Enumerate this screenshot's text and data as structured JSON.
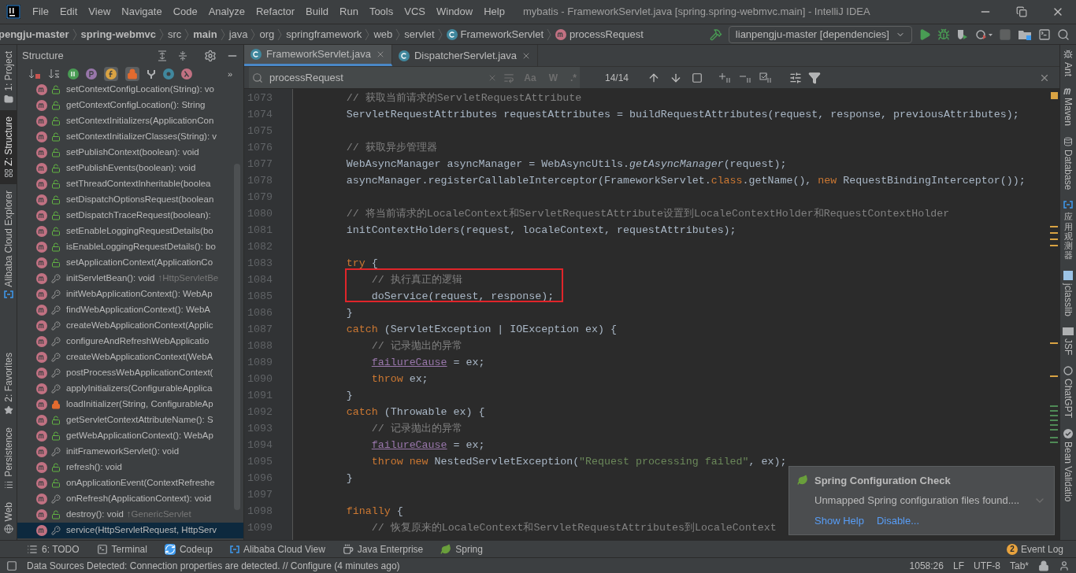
{
  "title_bar": {
    "menus": [
      "File",
      "Edit",
      "View",
      "Navigate",
      "Code",
      "Analyze",
      "Refactor",
      "Build",
      "Run",
      "Tools",
      "VCS",
      "Window",
      "Help"
    ],
    "title": "mybatis - FrameworkServlet.java [spring.spring-webmvc.main] - IntelliJ IDEA"
  },
  "nav_bar": {
    "breadcrumbs": [
      {
        "label": "pengju-master",
        "bold": true,
        "kind": "folder"
      },
      {
        "label": "spring-webmvc",
        "bold": true,
        "kind": "folder"
      },
      {
        "label": "src",
        "bold": false,
        "kind": "folder"
      },
      {
        "label": "main",
        "bold": true,
        "kind": "folder"
      },
      {
        "label": "java",
        "bold": false,
        "kind": "folder"
      },
      {
        "label": "org",
        "bold": false,
        "kind": "folder"
      },
      {
        "label": "springframework",
        "bold": false,
        "kind": "folder"
      },
      {
        "label": "web",
        "bold": false,
        "kind": "folder"
      },
      {
        "label": "servlet",
        "bold": false,
        "kind": "folder"
      },
      {
        "label": "FrameworkServlet",
        "bold": false,
        "kind": "class"
      },
      {
        "label": "processRequest",
        "bold": false,
        "kind": "method"
      }
    ],
    "run_config": "lianpengju-master [dependencies]"
  },
  "left_stripe": {
    "top": [
      {
        "label": "1: Project",
        "selected": false,
        "kind": "folder"
      },
      {
        "label": "Z: Structure",
        "selected": true,
        "kind": "structure"
      },
      {
        "label": "Alibaba Cloud Explorer",
        "selected": false,
        "kind": "cloud"
      }
    ],
    "bottom": [
      {
        "label": "2: Favorites",
        "selected": false,
        "kind": "star"
      },
      {
        "label": "Persistence",
        "selected": false,
        "kind": "persistence"
      },
      {
        "label": "Web",
        "selected": false,
        "kind": "globe"
      }
    ]
  },
  "structure": {
    "title": "Structure",
    "more": "»",
    "items": [
      {
        "text": "setContextConfigLocation(String): vo",
        "kind": "public",
        "selected": false
      },
      {
        "text": "getContextConfigLocation(): String",
        "kind": "public",
        "selected": false
      },
      {
        "text": "setContextInitializers(ApplicationCon",
        "kind": "public",
        "selected": false
      },
      {
        "text": "setContextInitializerClasses(String): v",
        "kind": "public",
        "selected": false
      },
      {
        "text": "setPublishContext(boolean): void",
        "kind": "public",
        "selected": false
      },
      {
        "text": "setPublishEvents(boolean): void",
        "kind": "public",
        "selected": false
      },
      {
        "text": "setThreadContextInheritable(boolea",
        "kind": "public",
        "selected": false
      },
      {
        "text": "setDispatchOptionsRequest(boolean",
        "kind": "public",
        "selected": false
      },
      {
        "text": "setDispatchTraceRequest(boolean):",
        "kind": "public",
        "selected": false
      },
      {
        "text": "setEnableLoggingRequestDetails(bo",
        "kind": "public",
        "selected": false
      },
      {
        "text": "isEnableLoggingRequestDetails(): bo",
        "kind": "public",
        "selected": false
      },
      {
        "text": "setApplicationContext(ApplicationCo",
        "kind": "public",
        "selected": false
      },
      {
        "text": "initServletBean(): void",
        "inherited": "↑HttpServletBe",
        "kind": "protected",
        "selected": false
      },
      {
        "text": "initWebApplicationContext(): WebAp",
        "kind": "protected",
        "selected": false
      },
      {
        "text": "findWebApplicationContext(): WebA",
        "kind": "protected",
        "selected": false
      },
      {
        "text": "createWebApplicationContext(Applic",
        "kind": "protected",
        "selected": false
      },
      {
        "text": "configureAndRefreshWebApplicatio",
        "kind": "protected",
        "selected": false
      },
      {
        "text": "createWebApplicationContext(WebA",
        "kind": "protected",
        "selected": false
      },
      {
        "text": "postProcessWebApplicationContext(",
        "kind": "protected",
        "selected": false
      },
      {
        "text": "applyInitializers(ConfigurableApplica",
        "kind": "protected",
        "selected": false
      },
      {
        "text": "loadInitializer(String, ConfigurableAp",
        "kind": "private",
        "selected": false
      },
      {
        "text": "getServletContextAttributeName(): S",
        "kind": "public",
        "selected": false
      },
      {
        "text": "getWebApplicationContext(): WebAp",
        "kind": "public",
        "selected": false
      },
      {
        "text": "initFrameworkServlet(): void",
        "kind": "protected",
        "selected": false
      },
      {
        "text": "refresh(): void",
        "kind": "public",
        "selected": false
      },
      {
        "text": "onApplicationEvent(ContextRefreshe",
        "kind": "public",
        "selected": false
      },
      {
        "text": "onRefresh(ApplicationContext): void",
        "kind": "protected",
        "selected": false
      },
      {
        "text": "destroy(): void",
        "inherited": "↑GenericServlet",
        "kind": "public",
        "selected": false
      },
      {
        "text": "service(HttpServletRequest, HttpServ",
        "kind": "protected",
        "selected": true
      }
    ]
  },
  "editor": {
    "tabs": [
      {
        "label": "FrameworkServlet.java",
        "selected": true
      },
      {
        "label": "DispatcherServlet.java",
        "selected": false
      }
    ],
    "search": {
      "value": "processRequest",
      "options": [
        "Aa",
        "W",
        ".*"
      ],
      "match_count": "14/14"
    },
    "lines": [
      {
        "number": "1073",
        "boxed": false,
        "segments": [
          {
            "kind": "comment",
            "text": "        // 获取当前请求的ServletRequestAttribute"
          }
        ]
      },
      {
        "number": "1074",
        "boxed": false,
        "segments": [
          {
            "kind": "plain",
            "text": "        ServletRequestAttributes requestAttributes = buildRequestAttributes(request, response, previousAttributes);"
          }
        ]
      },
      {
        "number": "1075",
        "boxed": false
      },
      {
        "number": "1076",
        "boxed": false,
        "segments": [
          {
            "kind": "comment",
            "text": "        // 获取异步管理器"
          }
        ]
      },
      {
        "number": "1077",
        "boxed": false,
        "segments": [
          {
            "kind": "plain",
            "text": "        WebAsyncManager asyncManager = WebAsyncUtils."
          },
          {
            "kind": "static",
            "text": "getAsyncManager"
          },
          {
            "kind": "plain",
            "text": "(request);"
          }
        ]
      },
      {
        "number": "1078",
        "boxed": false,
        "segments": [
          {
            "kind": "plain",
            "text": "        asyncManager.registerCallableInterceptor(FrameworkServlet."
          },
          {
            "kind": "keyword",
            "text": "class"
          },
          {
            "kind": "plain",
            "text": ".getName(), "
          },
          {
            "kind": "keyword",
            "text": "new"
          },
          {
            "kind": "plain",
            "text": " RequestBindingInterceptor());"
          }
        ]
      },
      {
        "number": "1079",
        "boxed": false
      },
      {
        "number": "1080",
        "boxed": false,
        "segments": [
          {
            "kind": "comment",
            "text": "        // 将当前请求的LocaleContext和ServletRequestAttribute设置到LocaleContextHolder和RequestContextHolder"
          }
        ]
      },
      {
        "number": "1081",
        "boxed": false,
        "segments": [
          {
            "kind": "plain",
            "text": "        initContextHolders(request, localeContext, requestAttributes);"
          }
        ]
      },
      {
        "number": "1082",
        "boxed": false
      },
      {
        "number": "1083",
        "boxed": false,
        "segments": [
          {
            "kind": "keyword",
            "text": "        try"
          },
          {
            "kind": "plain",
            "text": " {"
          }
        ]
      },
      {
        "number": "1084",
        "boxed": true,
        "segments": [
          {
            "kind": "comment",
            "text": "            // 执行真正的逻辑"
          }
        ]
      },
      {
        "number": "1085",
        "boxed": true,
        "segments": [
          {
            "kind": "plain",
            "text": "            doService(request, response);"
          }
        ]
      },
      {
        "number": "1086",
        "boxed": false,
        "segments": [
          {
            "kind": "plain",
            "text": "        }"
          }
        ]
      },
      {
        "number": "1087",
        "boxed": false,
        "segments": [
          {
            "kind": "keyword",
            "text": "        catch"
          },
          {
            "kind": "plain",
            "text": " (ServletException | IOException ex) {"
          }
        ]
      },
      {
        "number": "1088",
        "boxed": false,
        "segments": [
          {
            "kind": "comment",
            "text": "            // 记录抛出的异常"
          }
        ]
      },
      {
        "number": "1089",
        "boxed": false,
        "segments": [
          {
            "kind": "field",
            "text": "            failureCause"
          },
          {
            "kind": "plain",
            "text": " = ex;"
          }
        ]
      },
      {
        "number": "1090",
        "boxed": false,
        "segments": [
          {
            "kind": "keyword",
            "text": "            throw"
          },
          {
            "kind": "plain",
            "text": " ex;"
          }
        ]
      },
      {
        "number": "1091",
        "boxed": false,
        "segments": [
          {
            "kind": "plain",
            "text": "        }"
          }
        ]
      },
      {
        "number": "1092",
        "boxed": false,
        "segments": [
          {
            "kind": "keyword",
            "text": "        catch"
          },
          {
            "kind": "plain",
            "text": " (Throwable ex) {"
          }
        ]
      },
      {
        "number": "1093",
        "boxed": false,
        "segments": [
          {
            "kind": "comment",
            "text": "            // 记录抛出的异常"
          }
        ]
      },
      {
        "number": "1094",
        "boxed": false,
        "segments": [
          {
            "kind": "field",
            "text": "            failureCause"
          },
          {
            "kind": "plain",
            "text": " = ex;"
          }
        ]
      },
      {
        "number": "1095",
        "boxed": false,
        "segments": [
          {
            "kind": "keyword",
            "text": "            throw new"
          },
          {
            "kind": "plain",
            "text": " NestedServletException("
          },
          {
            "kind": "string",
            "text": "\"Request processing failed\""
          },
          {
            "kind": "plain",
            "text": ", ex);"
          }
        ]
      },
      {
        "number": "1096",
        "boxed": false,
        "segments": [
          {
            "kind": "plain",
            "text": "        }"
          }
        ]
      },
      {
        "number": "1097",
        "boxed": false
      },
      {
        "number": "1098",
        "boxed": false,
        "segments": [
          {
            "kind": "keyword",
            "text": "        finally"
          },
          {
            "kind": "plain",
            "text": " {"
          }
        ]
      },
      {
        "number": "1099",
        "boxed": false,
        "segments": [
          {
            "kind": "comment",
            "text": "            // 恢复原来的LocaleContext和ServletRequestAttributes到LocaleContext"
          }
        ]
      }
    ]
  },
  "notification": {
    "title": "Spring Configuration Check",
    "body": "Unmapped Spring configuration files found....",
    "links": [
      "Show Help",
      "Disable..."
    ]
  },
  "right_stripe": [
    {
      "label": "Ant",
      "kind": "ant"
    },
    {
      "label": "Maven",
      "kind": "maven"
    },
    {
      "label": "Database",
      "kind": "database"
    },
    {
      "label": "应用观测器",
      "kind": "observe"
    },
    {
      "label": "jclasslib",
      "kind": "jclasslib"
    },
    {
      "label": "JSF",
      "kind": "jsf"
    },
    {
      "label": "ChatGPT",
      "kind": "chatgpt"
    },
    {
      "label": "Bean Validatio",
      "kind": "bean"
    }
  ],
  "bottom_tools": [
    {
      "label": "6: TODO",
      "kind": "todo"
    },
    {
      "label": "Terminal",
      "kind": "terminal"
    },
    {
      "label": "Codeup",
      "kind": "codeup"
    },
    {
      "label": "Alibaba Cloud View",
      "kind": "cloud"
    },
    {
      "label": "Java Enterprise",
      "kind": "javaee"
    },
    {
      "label": "Spring",
      "kind": "spring"
    }
  ],
  "event_log": {
    "label": "Event Log",
    "count": "2"
  },
  "status_bar": {
    "message": "Data Sources Detected: Connection properties are detected. // Configure (4 minutes ago)",
    "position": "1058:26",
    "line_separator": "LF",
    "encoding": "UTF-8",
    "indent": "Tab*"
  }
}
